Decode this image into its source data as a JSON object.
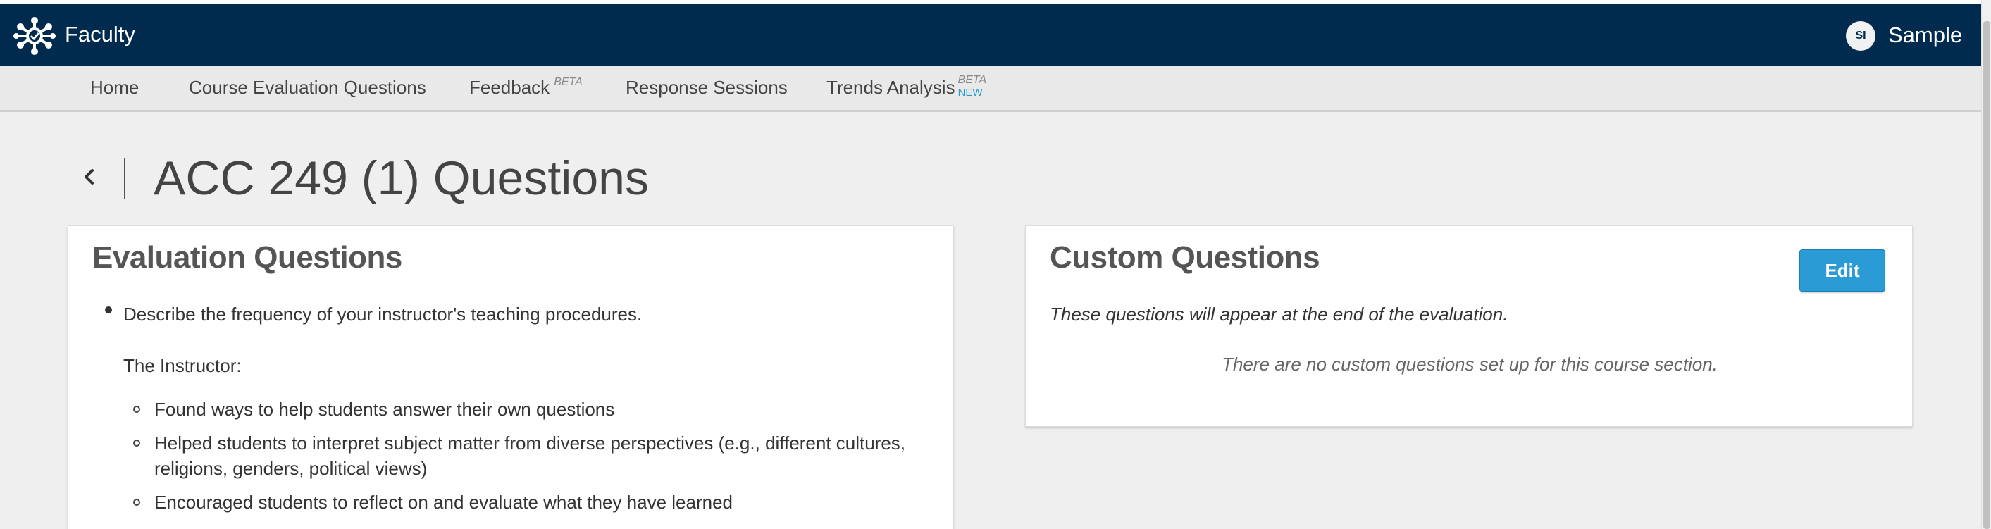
{
  "header": {
    "app_name": "Faculty",
    "user_initials": "SI",
    "user_name": "Sample",
    "logo_icon": "network-hub-icon"
  },
  "nav": {
    "items": [
      {
        "label": "Home"
      },
      {
        "label": "Course Evaluation Questions"
      },
      {
        "label": "Feedback",
        "badge": "BETA"
      },
      {
        "label": "Response Sessions"
      },
      {
        "label": "Trends Analysis",
        "badge": "BETA",
        "badge2": "NEW"
      }
    ]
  },
  "page": {
    "title": "ACC 249 (1) Questions",
    "back_icon": "chevron-left-icon"
  },
  "evaluation": {
    "title": "Evaluation Questions",
    "question": "Describe the frequency of your instructor's teaching procedures.",
    "intro": "The Instructor:",
    "items": [
      "Found ways to help students answer their own questions",
      "Helped students to interpret subject matter from diverse perspectives (e.g., different cultures, religions, genders, political views)",
      "Encouraged students to reflect on and evaluate what they have learned"
    ]
  },
  "custom": {
    "title": "Custom Questions",
    "edit_label": "Edit",
    "note": "These questions will appear at the end of the evaluation.",
    "empty_message": "There are no custom questions set up for this course section."
  },
  "colors": {
    "header_bg": "#002b4f",
    "accent": "#2a9bd4",
    "page_bg": "#efefef"
  }
}
